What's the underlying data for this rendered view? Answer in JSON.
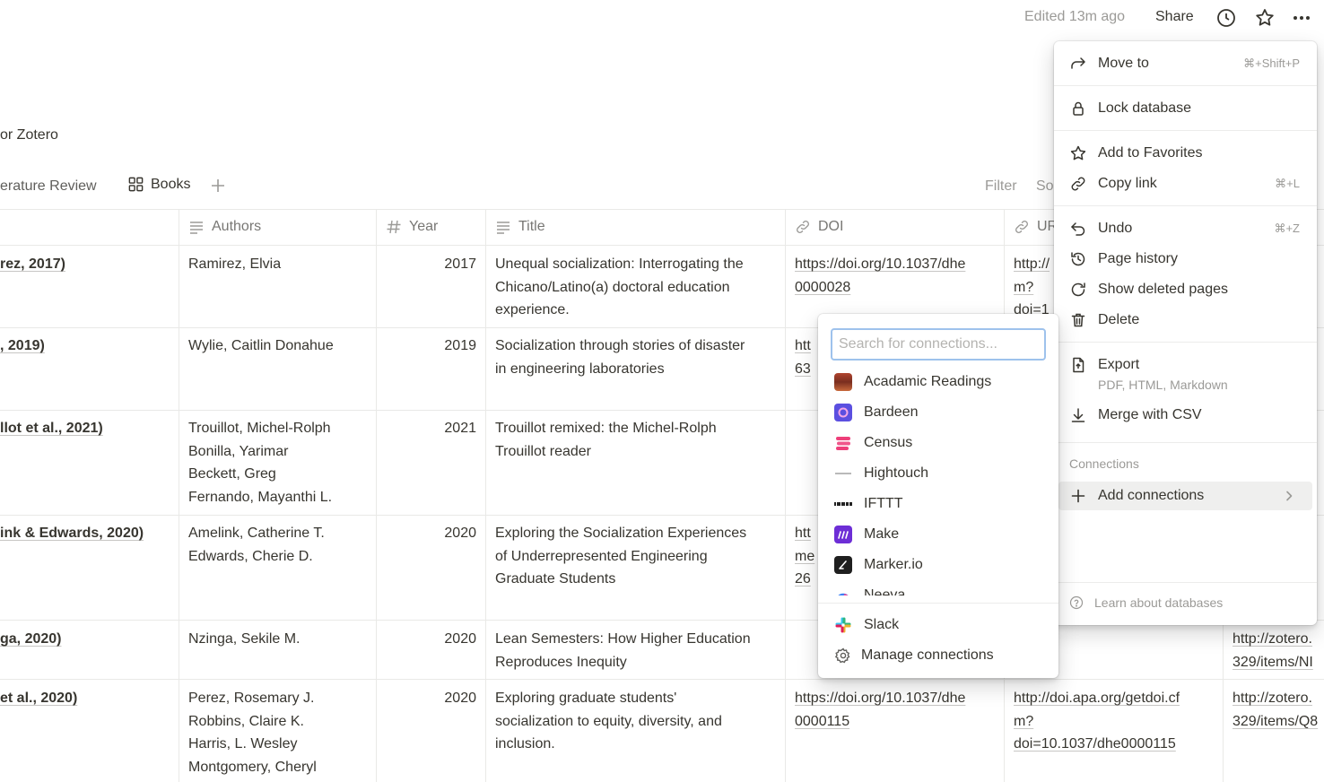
{
  "topbar": {
    "edited": "Edited 13m ago",
    "share": "Share",
    "icons": [
      "clock-icon",
      "star-icon",
      "more-icon"
    ]
  },
  "database": {
    "title": "or Zotero"
  },
  "views": {
    "tab1": "erature Review",
    "tab2": "Books",
    "filter": "Filter",
    "sort": "So"
  },
  "table": {
    "columns": [
      "Authors",
      "Year",
      "Title",
      "DOI",
      "UR"
    ],
    "rows": [
      {
        "name": "rez, 2017)",
        "authors": [
          "Ramirez, Elvia"
        ],
        "year": "2017",
        "title": [
          "Unequal socialization: Interrogating the",
          "Chicano/Latino(a) doctoral education",
          "experience."
        ],
        "doi": [
          "https://doi.org/10.1037/dhe",
          "0000028"
        ],
        "url": [
          "http://",
          "m?",
          "doi=1"
        ]
      },
      {
        "name": ", 2019)",
        "authors": [
          "Wylie, Caitlin Donahue"
        ],
        "year": "2019",
        "title": [
          "Socialization through stories of disaster",
          "in engineering laboratories"
        ],
        "doi": [
          "htt",
          "63"
        ],
        "url": []
      },
      {
        "name": "llot et al., 2021)",
        "authors": [
          "Trouillot, Michel-Rolph",
          "Bonilla, Yarimar",
          "Beckett, Greg",
          "Fernando, Mayanthi L."
        ],
        "year": "2021",
        "title": [
          "Trouillot remixed: the Michel-Rolph",
          "Trouillot reader"
        ],
        "doi": [],
        "url": []
      },
      {
        "name": "ink & Edwards, 2020)",
        "authors": [
          "Amelink, Catherine T.",
          "Edwards, Cherie D."
        ],
        "year": "2020",
        "title": [
          "Exploring the Socialization Experiences",
          "of Underrepresented Engineering",
          "Graduate Students"
        ],
        "doi": [
          "htt",
          "me",
          "26"
        ],
        "url": []
      },
      {
        "name": "ga, 2020)",
        "authors": [
          "Nzinga, Sekile M."
        ],
        "year": "2020",
        "title": [
          "Lean Semesters: How Higher Education",
          "Reproduces Inequity"
        ],
        "doi": [],
        "url": [],
        "extra": [
          "http://zotero.",
          "329/items/NI"
        ]
      },
      {
        "name": "et al., 2020)",
        "authors": [
          "Perez, Rosemary J.",
          "Robbins, Claire K.",
          "Harris, L. Wesley",
          "Montgomery, Cheryl"
        ],
        "year": "2020",
        "title": [
          "Exploring graduate students'",
          "socialization to equity, diversity, and",
          "inclusion."
        ],
        "doi": [
          "https://doi.org/10.1037/dhe",
          "0000115"
        ],
        "url": [
          "http://doi.apa.org/getdoi.cf",
          "m?",
          "doi=10.1037/dhe0000115"
        ],
        "extra": [
          "http://zotero.",
          "329/items/Q8"
        ]
      }
    ]
  },
  "menu": {
    "items": [
      {
        "label": "Move to",
        "shortcut": "⌘+Shift+P",
        "icon": "arrow-right-icon"
      },
      {
        "label": "Lock database",
        "icon": "lock-icon"
      },
      {
        "label": "Add to Favorites",
        "icon": "star-icon"
      },
      {
        "label": "Copy link",
        "shortcut": "⌘+L",
        "icon": "link-icon"
      },
      {
        "label": "Undo",
        "shortcut": "⌘+Z",
        "icon": "undo-icon"
      },
      {
        "label": "Page history",
        "icon": "history-icon"
      },
      {
        "label": "Show deleted pages",
        "icon": "restore-icon"
      },
      {
        "label": "Delete",
        "icon": "trash-icon"
      },
      {
        "label": "Export",
        "sublabel": "PDF, HTML, Markdown",
        "icon": "export-icon"
      },
      {
        "label": "Merge with CSV",
        "icon": "download-icon"
      }
    ],
    "connections_section": "Connections",
    "add_connections": "Add connections",
    "learn": "Learn about databases"
  },
  "connections": {
    "placeholder": "Search for connections...",
    "items": [
      {
        "label": "Acadamic Readings",
        "color": "#8b3a2a"
      },
      {
        "label": "Bardeen",
        "color": "#5b4fe0"
      },
      {
        "label": "Census",
        "color": "#ee3f7a"
      },
      {
        "label": "Hightouch",
        "color": "#b9b9b9"
      },
      {
        "label": "IFTTT",
        "color": "#222222"
      },
      {
        "label": "Make",
        "color": "#6d2ed6"
      },
      {
        "label": "Marker.io",
        "color": "#1f1f1f"
      },
      {
        "label": "Neeva",
        "color": "#3b82f6"
      }
    ],
    "slack": "Slack",
    "manage": "Manage connections"
  }
}
